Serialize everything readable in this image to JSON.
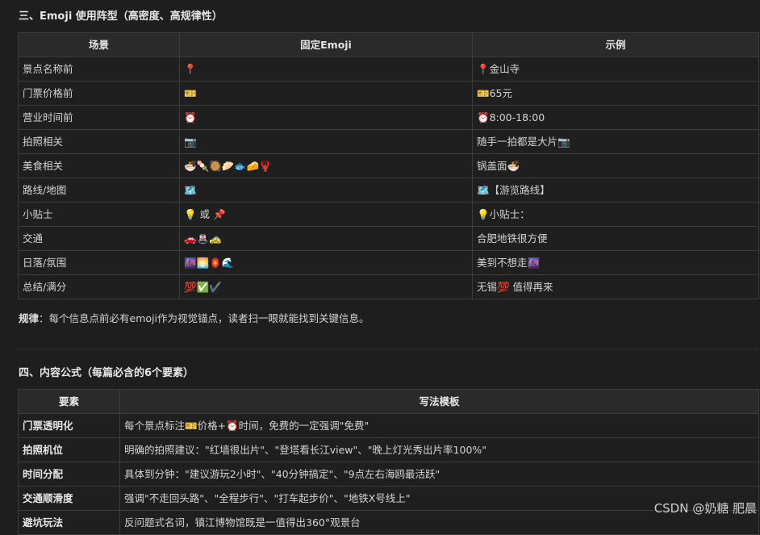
{
  "section3": {
    "title": "三、Emoji 使用阵型（高密度、高规律性）",
    "headers": [
      "场景",
      "固定Emoji",
      "示例"
    ],
    "rows": [
      [
        "景点名称前",
        "📍",
        "📍金山寺"
      ],
      [
        "门票价格前",
        "🎫",
        "🎫65元"
      ],
      [
        "营业时间前",
        "⏰",
        "⏰8:00-18:00"
      ],
      [
        "拍照相关",
        "📷",
        "随手一拍都是大片📷"
      ],
      [
        "美食相关",
        "🍜🍡🥘🥟🐟🧀🦞",
        "锅盖面🍜"
      ],
      [
        "路线/地图",
        "🗺️",
        "🗺️【游览路线】"
      ],
      [
        "小贴士",
        "💡 或 📌",
        "💡小贴士："
      ],
      [
        "交通",
        "🚗🚇🚕",
        "合肥地铁很方便"
      ],
      [
        "日落/氛围",
        "🌆🌅🏮🌊",
        "美到不想走🌆"
      ],
      [
        "总结/满分",
        "💯✅✔️",
        "无锡💯 值得再来"
      ]
    ],
    "rule_label": "规律",
    "rule_text": "：每个信息点前必有emoji作为视觉锚点，读者扫一眼就能找到关键信息。"
  },
  "section4": {
    "title": "四、内容公式（每篇必含的6个要素）",
    "headers": [
      "要素",
      "写法模板"
    ],
    "rows": [
      [
        "门票透明化",
        "每个景点标注🎫价格+⏰时间，免费的一定强调\"免费\""
      ],
      [
        "拍照机位",
        "明确的拍照建议：\"红墙很出片\"、\"登塔看长江view\"、\"晚上灯光秀出片率100%\""
      ],
      [
        "时间分配",
        "具体到分钟：\"建议游玩2小时\"、\"40分钟搞定\"、\"9点左右海鸥最活跃\""
      ],
      [
        "交通顺滑度",
        "强调\"不走回头路\"、\"全程步行\"、\"打车起步价\"、\"地铁X号线上\""
      ],
      [
        "避坑玩法",
        "反问题式名词，镇江博物馆既是一值得出360°观景台"
      ]
    ]
  },
  "watermark": "CSDN @奶糖 肥晨"
}
